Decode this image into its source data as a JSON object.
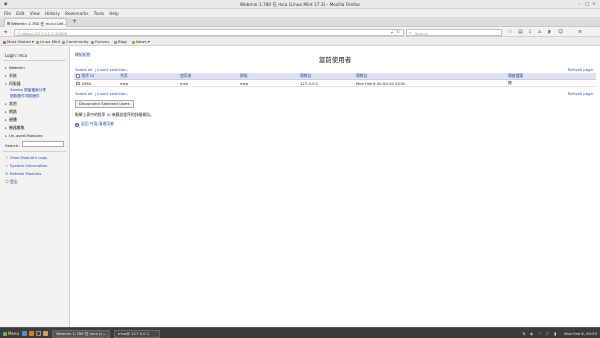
{
  "window": {
    "title": "Webmin 1.780 在 mca (Linux Mint 17.3) - Mozilla Firefox"
  },
  "menubar": [
    "File",
    "Edit",
    "View",
    "History",
    "Bookmarks",
    "Tools",
    "Help"
  ],
  "tab": {
    "label": "Webmin 1.780 在 mca (Lin...",
    "close": "×",
    "new_tab": "+"
  },
  "navbar": {
    "url": "https://127.0.0.1:10000",
    "search_placeholder": "Search"
  },
  "bookmarks": [
    {
      "label": "Most Visited ▾",
      "color": "#d9534f"
    },
    {
      "label": "Linux Mint",
      "color": "#7ab34a"
    },
    {
      "label": "Community",
      "color": "#7ab34a"
    },
    {
      "label": "Forums",
      "color": "#7ab34a"
    },
    {
      "label": "Blog",
      "color": "#7ab34a"
    },
    {
      "label": "News ▾",
      "color": "#e58b2f"
    }
  ],
  "sidebar": {
    "login": "Login: mca",
    "categories": [
      {
        "label": "Webmin",
        "arrow": "▸"
      },
      {
        "label": "系統",
        "arrow": "▸"
      },
      {
        "label": "伺服器",
        "arrow": "▾"
      },
      {
        "label": "其他",
        "arrow": "▸"
      },
      {
        "label": "網路",
        "arrow": "▸"
      },
      {
        "label": "硬體",
        "arrow": "▸"
      },
      {
        "label": "機器叢集",
        "arrow": "▸"
      },
      {
        "label": "Un-used Modules",
        "arrow": "▸"
      }
    ],
    "subitems": [
      "Samba 視窗檔案分享",
      "讀取郵件伺服器件"
    ],
    "search_label": "Search:",
    "links": [
      {
        "label": "View Module's Logs",
        "icon": "!"
      },
      {
        "label": "System Information",
        "icon": "i"
      },
      {
        "label": "Refresh Modules",
        "icon": "↻"
      },
      {
        "label": "登出",
        "icon": "⏻"
      }
    ]
  },
  "main": {
    "breadcrumb": "模組組態",
    "title": "當前使用者",
    "select_links": "Select all. | Invert selection.",
    "refresh": "Refresh page.",
    "columns": [
      "程序 ID",
      "共用",
      "使用者",
      "群組",
      "連線自",
      "連線自",
      "開啟檔案"
    ],
    "rows": [
      [
        "2964",
        "mca",
        "mca",
        "mca",
        "127.0.0.1",
        "Mon Feb 8 00:50:19 2016",
        "無"
      ]
    ],
    "disconnect_button": "Disconnect Selected Users",
    "note_prefix": "點擊上表中的程序",
    "note_link": "ID",
    "note_suffix": "來觀該程序的詳細資訊。",
    "back_link": "返回 共用/清理用者"
  },
  "taskbar": {
    "menu": "Menu",
    "windows": [
      "Webmin 1.780 在 mca (L...",
      "mca@ 127.0.0.1"
    ],
    "clock": "Mon Feb 8, 00:53"
  }
}
